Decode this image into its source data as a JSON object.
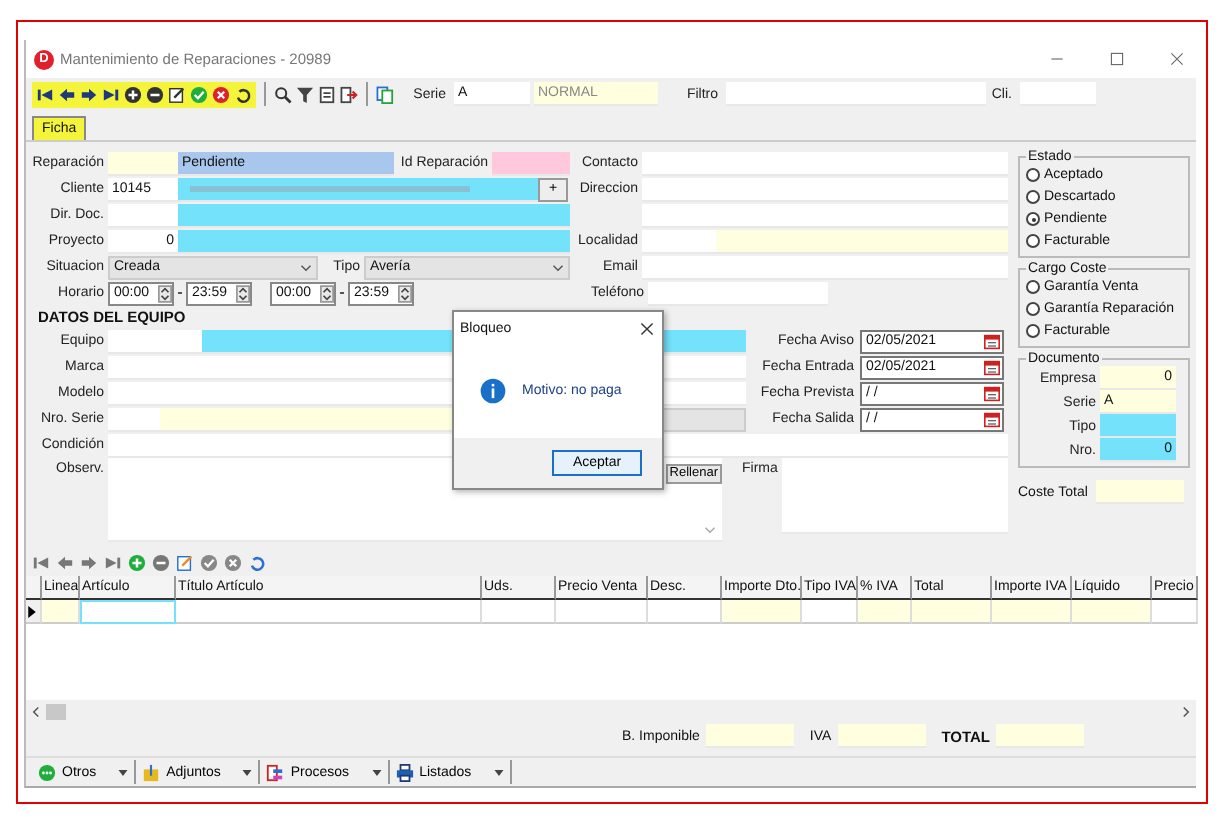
{
  "window": {
    "title": "Mantenimiento de Reparaciones - 20989",
    "app_icon": "D"
  },
  "toolbar": {
    "serie_label": "Serie",
    "serie_value": "A",
    "serie_name": "NORMAL",
    "filter_label": "Filtro",
    "client_label": "Cli."
  },
  "tabs": [
    {
      "label": "Ficha",
      "selected": true
    }
  ],
  "form": {
    "reparacion_label": "Reparación",
    "status": "Pendiente",
    "id_label": "Id Reparación",
    "cliente_label": "Cliente",
    "cliente_code": "10145",
    "plus": "+",
    "dir_doc_label": "Dir. Doc.",
    "proyecto_label": "Proyecto",
    "proyecto_value": "0",
    "situacion_label": "Situacion",
    "situacion_value": "Creada",
    "tipo_label": "Tipo",
    "tipo_value": "Avería",
    "horario_label": "Horario",
    "times": [
      "00:00",
      "23:59",
      "00:00",
      "23:59"
    ],
    "contacto_label": "Contacto",
    "direccion_label": "Direccion",
    "localidad_label": "Localidad",
    "email_label": "Email",
    "telefono_label": "Teléfono"
  },
  "equipment": {
    "heading": "DATOS DEL EQUIPO",
    "fields": [
      {
        "label": "Equipo",
        "kind": "code-cyan"
      },
      {
        "label": "Marca",
        "kind": "plain"
      },
      {
        "label": "Modelo",
        "kind": "plain"
      },
      {
        "label": "Nro. Serie",
        "kind": "code-yellow"
      },
      {
        "label": "Condición",
        "kind": "wide"
      }
    ],
    "observ_label": "Observ.",
    "rellenar": "Rellenar",
    "firma_label": "Firma"
  },
  "dates": [
    {
      "label": "Fecha Aviso",
      "value": "02/05/2021"
    },
    {
      "label": "Fecha Entrada",
      "value": "02/05/2021"
    },
    {
      "label": "Fecha Prevista",
      "value": " / /"
    },
    {
      "label": "Fecha Salida",
      "value": " / /"
    }
  ],
  "estado": {
    "title": "Estado",
    "options": [
      {
        "label": "Aceptado",
        "selected": false
      },
      {
        "label": "Descartado",
        "selected": false
      },
      {
        "label": "Pendiente",
        "selected": true
      },
      {
        "label": "Facturable",
        "selected": false
      }
    ]
  },
  "cargo": {
    "title": "Cargo Coste",
    "options": [
      {
        "label": "Garantía Venta",
        "selected": false
      },
      {
        "label": "Garantía Reparación",
        "selected": false
      },
      {
        "label": "Facturable",
        "selected": false
      }
    ]
  },
  "documento": {
    "title": "Documento",
    "fields": [
      {
        "label": "Empresa",
        "value": "0",
        "kind": "readonly"
      },
      {
        "label": "Serie",
        "value": "A",
        "kind": "readonly"
      },
      {
        "label": "Tipo",
        "kind": "link"
      },
      {
        "label": "Nro.",
        "value": "0",
        "kind": "link"
      }
    ]
  },
  "coste_total_label": "Coste Total",
  "table": {
    "columns": [
      {
        "label": "Linea",
        "readonly": true,
        "focused": false
      },
      {
        "label": "Artículo",
        "readonly": false,
        "focused": true
      },
      {
        "label": "Título Artículo",
        "readonly": false,
        "focused": false
      },
      {
        "label": "Uds.",
        "readonly": false,
        "focused": false
      },
      {
        "label": "Precio Venta",
        "readonly": false,
        "focused": false
      },
      {
        "label": "Desc.",
        "readonly": false,
        "focused": false
      },
      {
        "label": "Importe Dto.",
        "readonly": true,
        "focused": false
      },
      {
        "label": "Tipo IVA",
        "readonly": false,
        "focused": false
      },
      {
        "label": "% IVA",
        "readonly": true,
        "focused": false
      },
      {
        "label": "Total",
        "readonly": true,
        "focused": false
      },
      {
        "label": "Importe IVA",
        "readonly": true,
        "focused": false
      },
      {
        "label": "Líquido",
        "readonly": true,
        "focused": false
      },
      {
        "label": "Precio",
        "readonly": false,
        "focused": false
      }
    ]
  },
  "totals": [
    {
      "label": "B. Imponible",
      "kind": "normal"
    },
    {
      "label": "IVA",
      "kind": "normal"
    },
    {
      "label": "TOTAL",
      "kind": "strong"
    }
  ],
  "bottom_buttons": [
    {
      "label": "Otros"
    },
    {
      "label": "Adjuntos"
    },
    {
      "label": "Procesos"
    },
    {
      "label": "Listados"
    }
  ],
  "dialog": {
    "title": "Bloqueo",
    "message": "Motivo: no paga",
    "button": "Aceptar"
  }
}
